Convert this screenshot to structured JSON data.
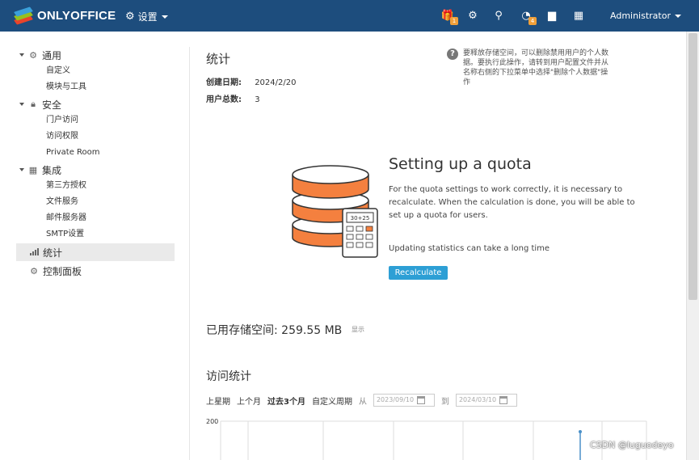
{
  "header": {
    "brand": "ONLYOFFICE",
    "settings_label": "设置",
    "user": "Administrator",
    "icons": [
      {
        "name": "gift-icon",
        "glyph": "🎁",
        "badge": "1"
      },
      {
        "name": "gear-icon",
        "glyph": "⚙",
        "badge": ""
      },
      {
        "name": "search-icon",
        "glyph": "⚲",
        "badge": ""
      },
      {
        "name": "feed-icon",
        "glyph": "◔",
        "badge": "4"
      },
      {
        "name": "chat-icon",
        "glyph": "▆",
        "badge": ""
      },
      {
        "name": "calendar-icon",
        "glyph": "▦",
        "badge": ""
      }
    ],
    "colors": {
      "bar": "#1d4d7d",
      "badge": "#f0a03a"
    }
  },
  "sidebar": {
    "groups": [
      {
        "label": "通用",
        "icon": "gear-icon",
        "items": [
          "自定义",
          "模块与工具"
        ]
      },
      {
        "label": "安全",
        "icon": "lock-icon",
        "items": [
          "门户访问",
          "访问权限",
          "Private Room"
        ]
      },
      {
        "label": "集成",
        "icon": "grid-icon",
        "items": [
          "第三方授权",
          "文件服务",
          "邮件服务器",
          "SMTP设置"
        ]
      }
    ],
    "stats_label": "统计",
    "control_label": "控制面板"
  },
  "main": {
    "title": "统计",
    "created_label": "创建日期:",
    "created_value": "2024/2/20",
    "users_label": "用户总数:",
    "users_value": "3",
    "help_text": "要释放存储空间，可以删除禁用用户的个人数据。要执行此操作，请转到用户配置文件并从名称右侧的下拉菜单中选择\"删除个人数据\"操作"
  },
  "quota": {
    "title": "Setting up a quota",
    "description": "For the quota settings to work correctly, it is necessary to recalculate. When the calculation is done, you will be able to set up a quota for users.",
    "note": "Updating statistics can take a long time",
    "button": "Recalculate",
    "calc_display": "30+25"
  },
  "storage": {
    "label": "已用存储空间: 259.55 MB",
    "show": "显示"
  },
  "visits": {
    "title": "访问统计",
    "periods": [
      "上星期",
      "上个月",
      "过去3个月",
      "自定义周期"
    ],
    "selected_period": "过去3个月",
    "from_label": "从",
    "to_label": "到",
    "from_date": "2023/09/10",
    "to_date": "2024/03/10"
  },
  "chart_data": {
    "type": "line",
    "y_tick_top": "200",
    "ylim": [
      0,
      200
    ],
    "grid": true
  },
  "watermark": "CSDN @luguodeyo"
}
